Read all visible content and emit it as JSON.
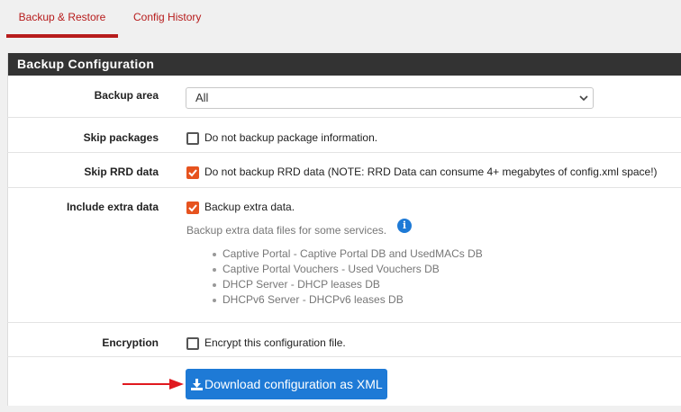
{
  "tabs": [
    {
      "label": "Backup & Restore",
      "active": true
    },
    {
      "label": "Config History",
      "active": false
    }
  ],
  "panel": {
    "title": "Backup Configuration"
  },
  "backup_area": {
    "label": "Backup area",
    "value": "All"
  },
  "skip_packages": {
    "label": "Skip packages",
    "text": "Do not backup package information.",
    "checked": false
  },
  "skip_rrd": {
    "label": "Skip RRD data",
    "text": "Do not backup RRD data (NOTE: RRD Data can consume 4+ megabytes of config.xml space!)",
    "checked": true
  },
  "extra_data": {
    "label": "Include extra data",
    "text": "Backup extra data.",
    "checked": true,
    "help": "Backup extra data files for some services.",
    "info_glyph": "i",
    "services": [
      "Captive Portal - Captive Portal DB and UsedMACs DB",
      "Captive Portal Vouchers - Used Vouchers DB",
      "DHCP Server - DHCP leases DB",
      "DHCPv6 Server - DHCPv6 leases DB"
    ]
  },
  "encryption": {
    "label": "Encryption",
    "text": "Encrypt this configuration file.",
    "checked": false
  },
  "download_button": {
    "label": "Download configuration as XML"
  },
  "colors": {
    "accent": "#b71c1c",
    "primary_button": "#1e7ad6",
    "checkbox_checked": "#e6531f",
    "annotation_arrow": "#e0191f"
  },
  "icons": {
    "select_chevron": "chevron-down-icon",
    "info": "info-icon",
    "download": "download-icon",
    "annotation": "red-arrow-icon"
  }
}
